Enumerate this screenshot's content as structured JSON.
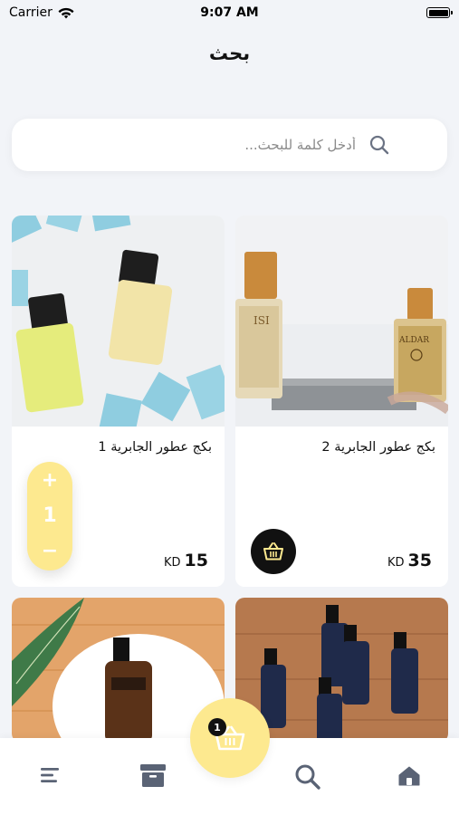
{
  "status": {
    "carrier": "Carrier",
    "time": "9:07 AM"
  },
  "header": {
    "title": "بحث"
  },
  "search": {
    "placeholder": "أدخل كلمة للبحث..."
  },
  "products": [
    {
      "name": "بكج عطور الجابرية 2",
      "price": "35",
      "currency": "KD"
    },
    {
      "name": "بكج عطور الجابرية 1",
      "price": "15",
      "currency": "KD",
      "quantity": "1"
    }
  ],
  "qty_controls": {
    "plus": "+",
    "minus": "−"
  },
  "cart": {
    "count": "1"
  },
  "nav": {
    "items": [
      "menu-icon",
      "archive-icon",
      "cart-icon",
      "search-icon",
      "home-icon"
    ]
  },
  "colors": {
    "accent": "#fde98f",
    "dark": "#111111",
    "nav_icon": "#5a6375"
  }
}
